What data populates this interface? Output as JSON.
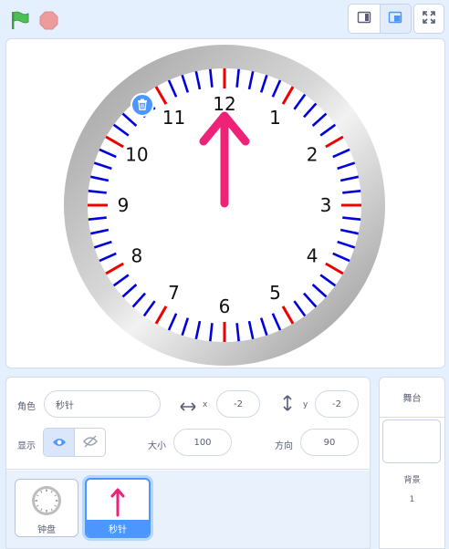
{
  "toolbar": {
    "green_flag": "green-flag-icon",
    "stop": "stop-icon",
    "small_stage": "small-stage-icon",
    "normal_stage": "normal-stage-icon",
    "fullscreen": "fullscreen-icon"
  },
  "stage": {
    "hour_numbers": [
      "12",
      "1",
      "2",
      "3",
      "4",
      "5",
      "6",
      "7",
      "8",
      "9",
      "10",
      "11"
    ],
    "hand_angle_deg": 0,
    "colors": {
      "minor_tick": "#0000dd",
      "major_tick": "#ee0000",
      "hand": "#ee2277"
    }
  },
  "sprite_info": {
    "sprite_label": "角色",
    "sprite_name": "秒针",
    "x_label": "x",
    "x_value": "-2",
    "y_label": "y",
    "y_value": "-2",
    "show_label": "显示",
    "size_label": "大小",
    "size_value": "100",
    "direction_label": "方向",
    "direction_value": "90"
  },
  "sprites": [
    {
      "name": "钟盘",
      "thumb": "clock-thumbnail",
      "selected": false
    },
    {
      "name": "秒针",
      "thumb": "arrow-thumbnail",
      "selected": true
    }
  ],
  "stage_panel": {
    "title": "舞台",
    "backdrop_label": "背景",
    "backdrop_count": "1"
  }
}
